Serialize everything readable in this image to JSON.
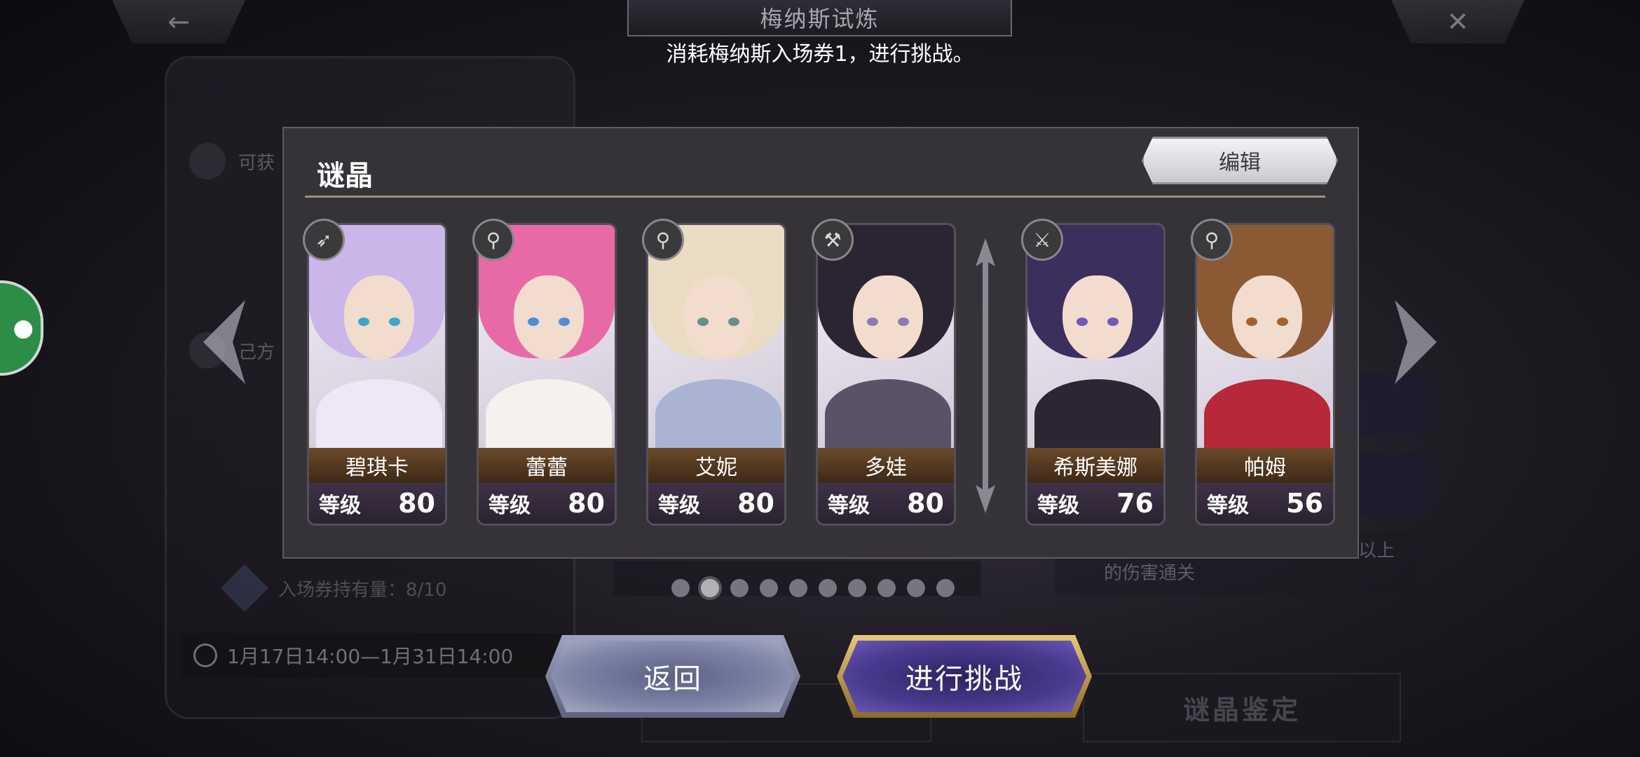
{
  "header": {
    "back_icon": "←",
    "close_icon": "✕",
    "title": "梅纳斯试炼",
    "subtitle": "消耗梅纳斯入场券1，进行挑战。"
  },
  "left_panel": {
    "row1_label": "可获",
    "row2_label": "己方",
    "ticket_label": "入场券持有量：8/10",
    "time_range": "1月17日14:00—1月31日14:00"
  },
  "right_panel": {
    "info_text": "的伤害通关",
    "info_text_top": "亿以上",
    "bottom_tab_label": "谜晶鉴定"
  },
  "chat_float_icon": "chat-bubble",
  "pager": {
    "count": 10,
    "active_index": 1
  },
  "dialog": {
    "title": "谜晶",
    "edit_label": "编辑",
    "level_label": "等级",
    "cards": [
      {
        "name": "碧琪卡",
        "level": "80",
        "class_icon": "bow",
        "hair": "#cbb6ea",
        "outfit": "#efe7f6",
        "eye": "#3aa7c9"
      },
      {
        "name": "蕾蕾",
        "level": "80",
        "class_icon": "staff",
        "hair": "#e76aa6",
        "outfit": "#f6f0ef",
        "eye": "#4b8fd6"
      },
      {
        "name": "艾妮",
        "level": "80",
        "class_icon": "staff",
        "hair": "#e9dcc3",
        "outfit": "#aab3d2",
        "eye": "#6a8d8e"
      },
      {
        "name": "多娃",
        "level": "80",
        "class_icon": "hammer",
        "hair": "#2b2533",
        "outfit": "#5a5266",
        "eye": "#8c7ab0"
      },
      {
        "name": "希斯美娜",
        "level": "76",
        "class_icon": "sword",
        "hair": "#3b2f5e",
        "outfit": "#2d2533",
        "eye": "#6d5bb8"
      },
      {
        "name": "帕姆",
        "level": "56",
        "class_icon": "staff",
        "hair": "#8b5a34",
        "outfit": "#b8273a",
        "eye": "#a0622e"
      }
    ]
  },
  "buttons": {
    "back_label": "返回",
    "challenge_label": "进行挑战"
  }
}
